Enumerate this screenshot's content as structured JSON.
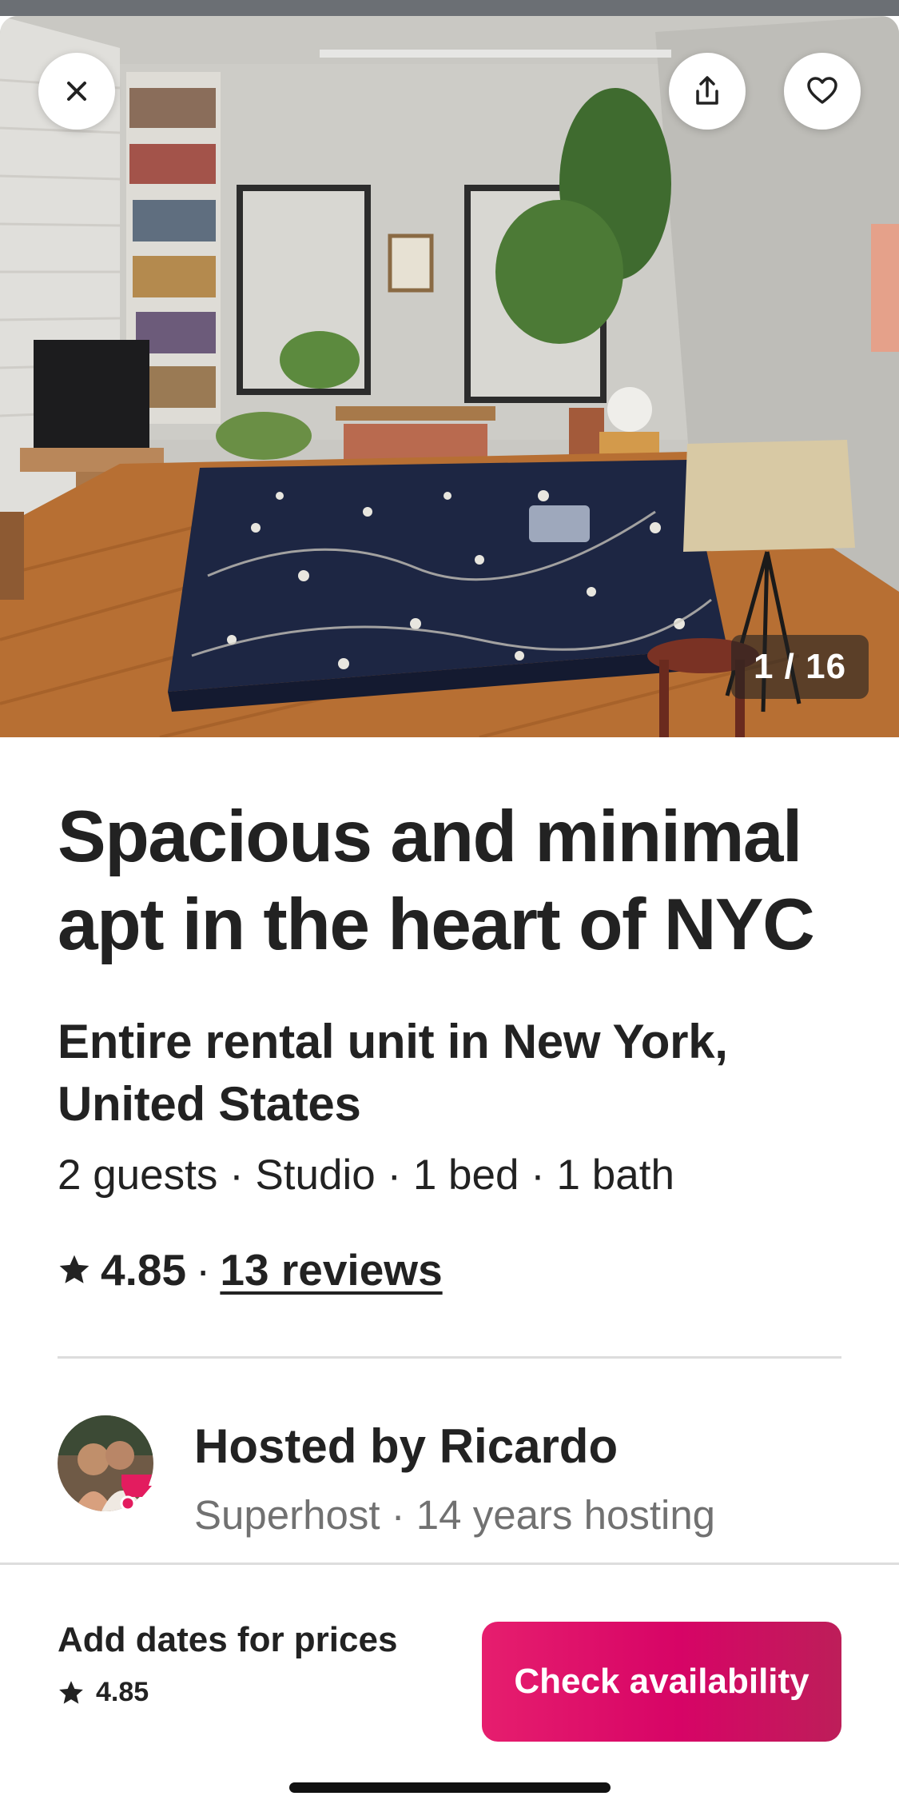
{
  "photo": {
    "counter": "1 / 16"
  },
  "icons": {
    "close": "close-icon",
    "share": "share-icon",
    "save": "heart-icon",
    "rating": "star-icon",
    "superhost": "superhost-badge-icon"
  },
  "listing": {
    "title": "Spacious and minimal apt in the heart of NYC",
    "subtitle": "Entire rental unit in New York, United States",
    "specs": "2 guests · Studio · 1 bed · 1 bath",
    "rating": "4.85",
    "separator": "·",
    "reviews": "13 reviews"
  },
  "host": {
    "name": "Hosted by Ricardo",
    "meta": "Superhost · 14 years hosting"
  },
  "footer": {
    "price_hint": "Add dates for prices",
    "rating": "4.85",
    "cta_label": "Check availability"
  },
  "colors": {
    "brand": "#E31C5F",
    "text": "#222222",
    "muted": "#717171",
    "divider": "#DDDDDD"
  }
}
